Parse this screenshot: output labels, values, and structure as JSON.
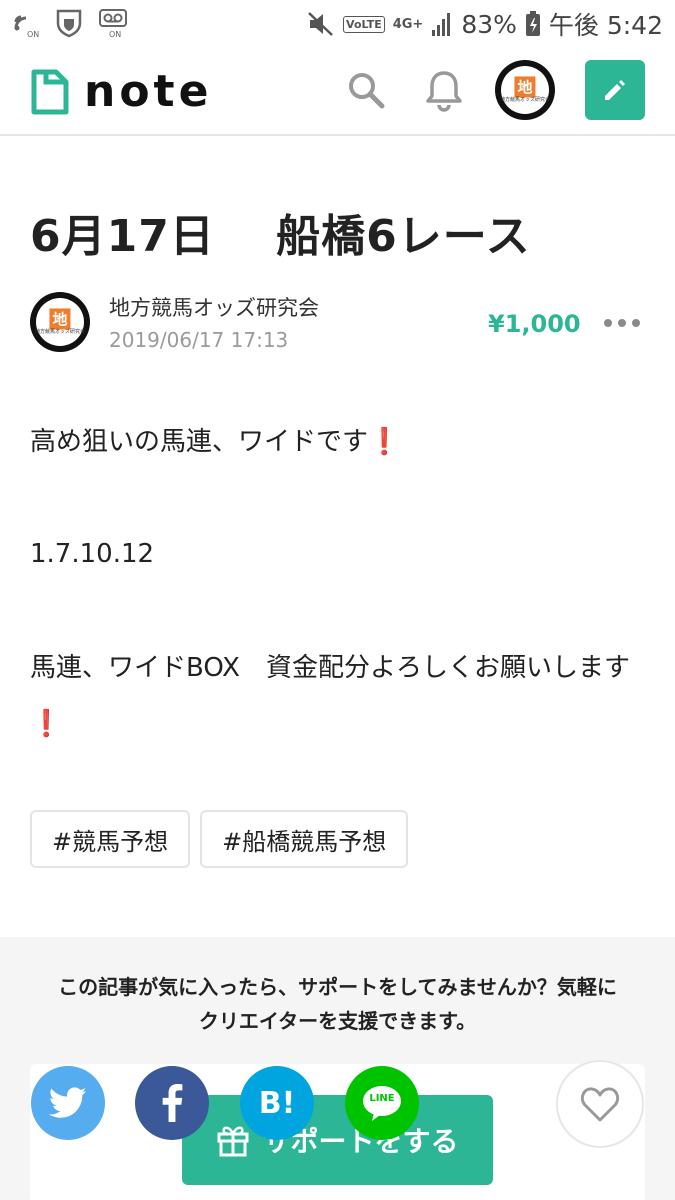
{
  "status_bar": {
    "battery": "83%",
    "time": "午後 5:42",
    "network": "4G+",
    "volte": "VoLTE"
  },
  "header": {
    "logo_text": "note",
    "icons": [
      "search-icon",
      "bell-icon",
      "pencil-icon"
    ]
  },
  "article": {
    "title": "6月17日　 船橋6レース",
    "author": "地方競馬オッズ研究会",
    "date": "2019/06/17 17:13",
    "price": "¥1,000",
    "paragraph1": "高め狙いの馬連、ワイドです",
    "paragraph2": "1.7.10.12",
    "paragraph3": "馬連、ワイドBOX　資金配分よろしくお願いします",
    "exclamation": "❗",
    "tags": [
      "#競馬予想",
      "#船橋競馬予想"
    ]
  },
  "avatar": {
    "mark": "地",
    "caption": "地方競馬オッズ研究会"
  },
  "support": {
    "line1": "この記事が気に入ったら、サポートをしてみませんか？気軽に",
    "line2": "クリエイターを支援できます。",
    "button_label": "サポートをする",
    "hatena_label": "B!",
    "line_label": "LINE"
  },
  "colors": {
    "brand_green": "#2cb696",
    "twitter": "#55acee",
    "facebook": "#3b5998",
    "hatena": "#00a4de",
    "line": "#00c300",
    "exclamation": "#d31a1a"
  }
}
